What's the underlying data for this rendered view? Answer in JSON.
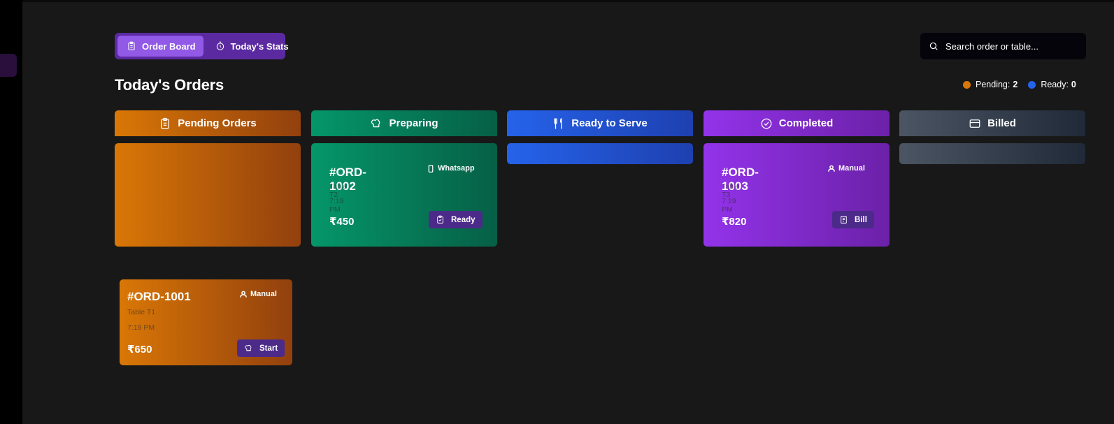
{
  "tabs": [
    {
      "label": "Order Board",
      "icon": "clipboard-icon",
      "active": true
    },
    {
      "label": "Today's Stats",
      "icon": "stopwatch-icon",
      "active": false
    }
  ],
  "search": {
    "placeholder": "Search order or table..."
  },
  "page_title": "Today's Orders",
  "legend": {
    "pending_label": "Pending:",
    "pending_count": "2",
    "pending_color": "#d97706",
    "ready_label": "Ready:",
    "ready_count": "0",
    "ready_color": "#2563eb"
  },
  "columns": [
    {
      "title": "Pending Orders",
      "icon": "clipboard-icon",
      "color": "#d97706"
    },
    {
      "title": "Preparing",
      "icon": "chef-hat-icon",
      "color": "#059669"
    },
    {
      "title": "Ready to Serve",
      "icon": "utensils-icon",
      "color": "#2563eb"
    },
    {
      "title": "Completed",
      "icon": "check-circle-icon",
      "color": "#9333ea"
    },
    {
      "title": "Billed",
      "icon": "credit-card-icon",
      "color": "#4b5563"
    }
  ],
  "orders": {
    "preparing": {
      "id": "#ORD-1002",
      "source": "Whatsapp",
      "table": "Table T2",
      "time": "7:19 PM",
      "amount": "₹450",
      "action": "Ready"
    },
    "completed": {
      "id": "#ORD-1003",
      "source": "Manual",
      "table": "Table T3",
      "time": "7:19 PM",
      "amount": "₹820",
      "action": "Bill"
    },
    "pending": {
      "id": "#ORD-1001",
      "source": "Manual",
      "table": "Table T1",
      "time": "7:19 PM",
      "amount": "₹650",
      "action": "Start"
    }
  }
}
